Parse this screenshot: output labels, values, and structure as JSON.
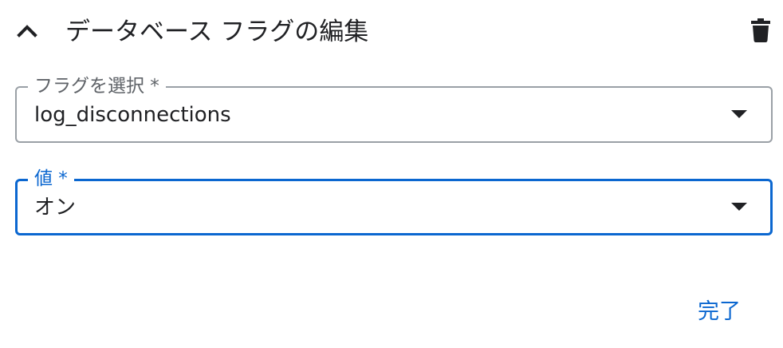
{
  "header": {
    "title": "データベース フラグの編集",
    "collapse_icon": "chevron-up-icon",
    "delete_icon": "trash-icon"
  },
  "flag_field": {
    "label": "フラグを選択 *",
    "value": "log_disconnections"
  },
  "value_field": {
    "label": "値 *",
    "value": "オン"
  },
  "footer": {
    "done_label": "完了"
  },
  "colors": {
    "accent": "#0b67d0",
    "text": "#202124",
    "label": "#5f6368",
    "border": "#9aa0a6"
  }
}
